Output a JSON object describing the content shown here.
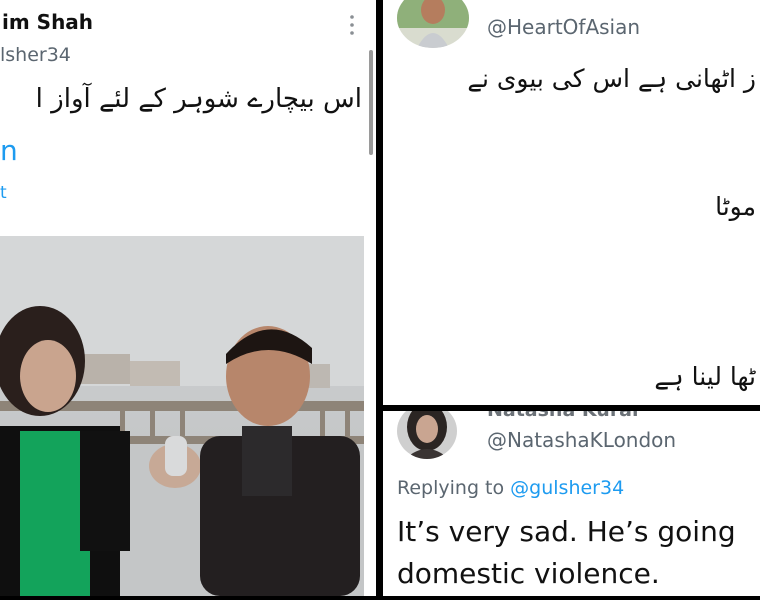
{
  "panels": {
    "left": {
      "author_name": "im Shah",
      "author_handle": "lsher34",
      "tweet_text": "اس بیچارے شوہر کے لئے آواز ا",
      "link_fragment_1": "n",
      "link_fragment_2": "t",
      "more_icon": "more-vertical-icon"
    },
    "top_right": {
      "author_handle": "@HeartOfAsian",
      "line_1": "ز اٹھانی ہے اس کی بیوی نے",
      "line_2": "موٹا",
      "line_3": "ٹھا لینا ہے"
    },
    "bottom_right": {
      "author_name": "Natasha Kural",
      "author_handle": "@NatashaKLondon",
      "replying_prefix": "Replying to",
      "replying_handle": "@gulsher34",
      "text_line_1": "It’s very sad. He’s going",
      "text_line_2": "domestic violence."
    }
  },
  "colors": {
    "link": "#1d9bf0",
    "muted": "#5b6670",
    "text": "#111111"
  }
}
